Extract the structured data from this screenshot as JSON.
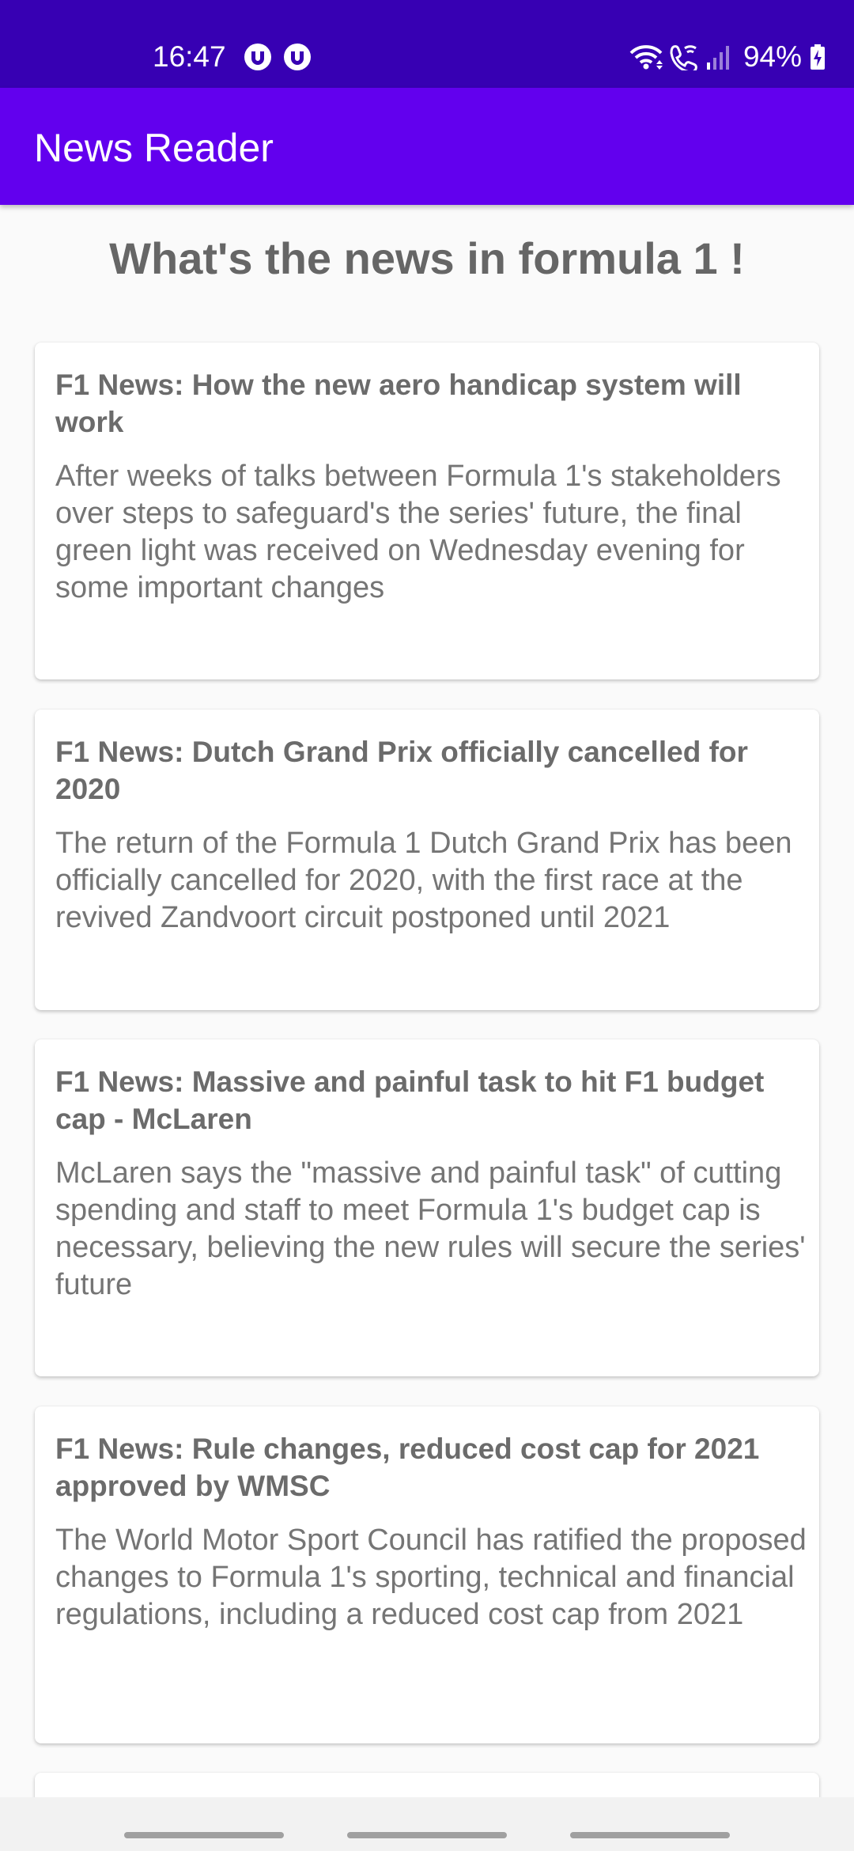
{
  "status_bar": {
    "time": "16:47",
    "battery": "94%",
    "app_icons": [
      "notification-app-icon",
      "notification-app-icon"
    ],
    "indicators": [
      "wifi-icon",
      "wifi-calling-icon",
      "signal-icon",
      "battery-charging-icon"
    ]
  },
  "app_bar": {
    "title": "News Reader",
    "color": "#6200ee",
    "status_color": "#3700b3"
  },
  "page": {
    "heading": "What's the news in formula 1 !"
  },
  "articles": [
    {
      "title": "F1 News: How the new aero handicap system will work",
      "description": "After weeks of talks between Formula 1's stakeholders over steps to safeguard's the series' future, the final green light was received on Wednesday evening for some important changes"
    },
    {
      "title": "F1 News: Dutch Grand Prix officially cancelled for 2020",
      "description": "The return of the Formula 1 Dutch Grand Prix has been officially cancelled for 2020, with the first race at the revived Zandvoort circuit postponed until 2021"
    },
    {
      "title": "F1 News: Massive and painful task to hit F1 budget cap - McLaren",
      "description": "McLaren says the \"massive and painful task\" of cutting spending and staff to meet Formula 1's budget cap is necessary, believing the new rules will secure the series' future"
    },
    {
      "title": "F1 News: Rule changes, reduced cost cap for 2021 approved by WMSC",
      "description": "The World Motor Sport Council has ratified the proposed changes to Formula 1's sporting, technical and financial regulations, including a reduced cost cap from 2021"
    }
  ]
}
